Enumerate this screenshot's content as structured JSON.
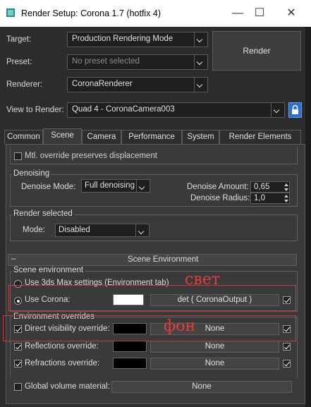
{
  "window": {
    "title": "Render Setup: Corona 1.7 (hotfix 4)",
    "min_glyph": "—",
    "max_glyph": "☐",
    "close_glyph": "✕"
  },
  "top": {
    "target_label": "Target:",
    "target_value": "Production Rendering Mode",
    "preset_label": "Preset:",
    "preset_value": "No preset selected",
    "renderer_label": "Renderer:",
    "renderer_value": "CoronaRenderer",
    "view_label": "View to Render:",
    "view_value": "Quad 4 - CoronaCamera003",
    "render_button": "Render"
  },
  "tabs": [
    "Common",
    "Scene",
    "Camera",
    "Performance",
    "System",
    "Render Elements"
  ],
  "scene": {
    "mtl_override_label": "Mtl. override preserves displacement",
    "denoising": {
      "title": "Denoising",
      "mode_label": "Denoise Mode:",
      "mode_value": "Full denoising",
      "amount_label": "Denoise Amount:",
      "amount_value": "0,65",
      "radius_label": "Denoise Radius:",
      "radius_value": "1,0"
    },
    "render_selected": {
      "title": "Render selected",
      "mode_label": "Mode:",
      "mode_value": "Disabled"
    },
    "rollout": {
      "collapse_glyph": "–",
      "title": "Scene Environment"
    },
    "scene_env": {
      "title": "Scene environment",
      "use_max_label": "Use 3ds Max settings (Environment tab)",
      "use_corona_label": "Use Corona:",
      "corona_map": "det  ( CoronaOutput )"
    },
    "overrides": {
      "title": "Environment overrides",
      "direct_label": "Direct visibility override:",
      "direct_map": "None",
      "reflections_label": "Reflections override:",
      "reflections_map": "None",
      "refractions_label": "Refractions override:",
      "refractions_map": "None"
    },
    "global_volume_label": "Global volume material:",
    "global_volume_map": "None"
  },
  "annotations": {
    "svet": "свет",
    "fon": "фон"
  },
  "colors": {
    "accent_lock": "#2b6fce",
    "annotation_red": "#d83030",
    "bg": "#2c2c2c",
    "panel": "#3a3a3a"
  }
}
